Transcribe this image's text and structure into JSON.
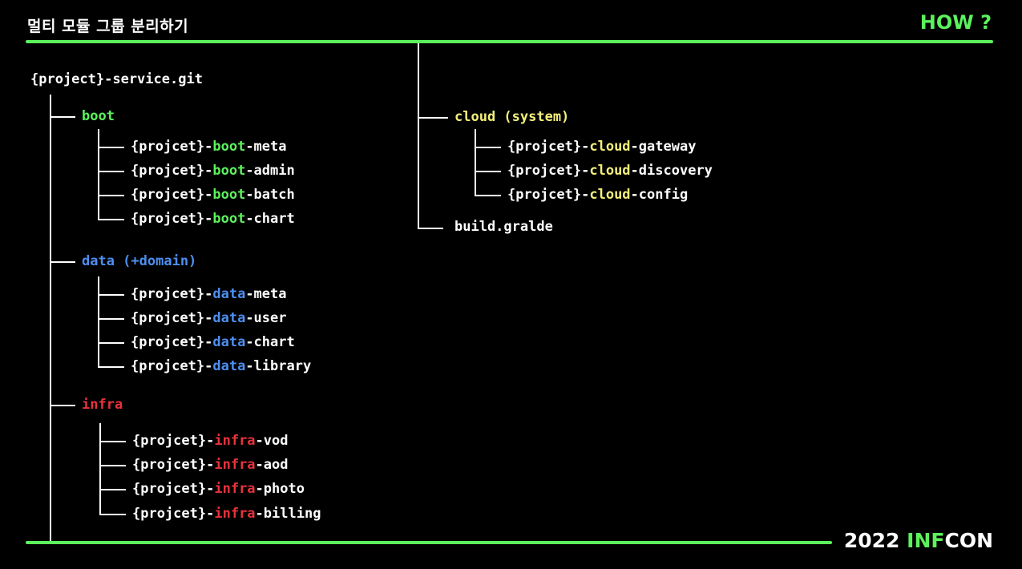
{
  "header": {
    "title": "멀티 모듈 그룹 분리하기",
    "tag": "HOW ?"
  },
  "footer": {
    "brand_year": "2022 ",
    "brand_inf": "INF",
    "brand_con": "CON"
  },
  "colors": {
    "accent_green": "#5cf25c",
    "boot": "#5cf25c",
    "data": "#4e8ff0",
    "infra": "#e8323a",
    "cloud": "#f5f07a",
    "text": "#ffffff",
    "background": "#000000"
  },
  "tree": {
    "root": "{project}-service.git",
    "groups": [
      {
        "key": "boot",
        "label": "boot",
        "modules": [
          {
            "prefix": "{projcet}-",
            "mid": "boot",
            "suffix": "-meta"
          },
          {
            "prefix": "{projcet}-",
            "mid": "boot",
            "suffix": "-admin"
          },
          {
            "prefix": "{projcet}-",
            "mid": "boot",
            "suffix": "-batch"
          },
          {
            "prefix": "{projcet}-",
            "mid": "boot",
            "suffix": "-chart"
          }
        ]
      },
      {
        "key": "data",
        "label": "data (+domain)",
        "modules": [
          {
            "prefix": "{projcet}-",
            "mid": "data",
            "suffix": "-meta"
          },
          {
            "prefix": "{projcet}-",
            "mid": "data",
            "suffix": "-user"
          },
          {
            "prefix": "{projcet}-",
            "mid": "data",
            "suffix": "-chart"
          },
          {
            "prefix": "{projcet}-",
            "mid": "data",
            "suffix": "-library"
          }
        ]
      },
      {
        "key": "infra",
        "label": "infra",
        "modules": [
          {
            "prefix": "{projcet}-",
            "mid": "infra",
            "suffix": "-vod"
          },
          {
            "prefix": "{projcet}-",
            "mid": "infra",
            "suffix": "-aod"
          },
          {
            "prefix": "{projcet}-",
            "mid": "infra",
            "suffix": "-photo"
          },
          {
            "prefix": "{projcet}-",
            "mid": "infra",
            "suffix": "-billing"
          }
        ]
      },
      {
        "key": "cloud",
        "label": "cloud (system)",
        "modules": [
          {
            "prefix": "{projcet}-",
            "mid": "cloud",
            "suffix": "-gateway"
          },
          {
            "prefix": "{projcet}-",
            "mid": "cloud",
            "suffix": "-discovery"
          },
          {
            "prefix": "{projcet}-",
            "mid": "cloud",
            "suffix": "-config"
          }
        ]
      }
    ],
    "build_file": "build.gralde"
  }
}
